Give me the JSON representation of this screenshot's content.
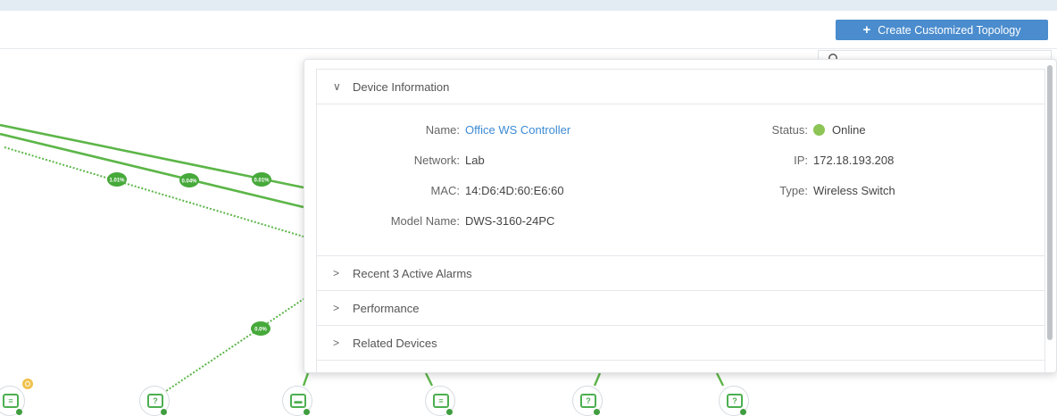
{
  "toolbar": {
    "create_button_label": "Create Customized Topology",
    "search_placeholder": "Search"
  },
  "topology": {
    "link_labels": [
      "1.01%",
      "0.04%",
      "0.01%",
      "0.0%"
    ],
    "link_color": "#5cb648",
    "alert_badge_color": "#f0c14b"
  },
  "panel": {
    "device_info": {
      "title": "Device Information",
      "name_label": "Name:",
      "name_value": "Office WS Controller",
      "network_label": "Network:",
      "network_value": "Lab",
      "mac_label": "MAC:",
      "mac_value": "14:D6:4D:60:E6:60",
      "model_label": "Model Name:",
      "model_value": "DWS-3160-24PC",
      "status_label": "Status:",
      "status_value": "Online",
      "status_color": "#8cc455",
      "ip_label": "IP:",
      "ip_value": "172.18.193.208",
      "type_label": "Type:",
      "type_value": "Wireless Switch"
    },
    "sections": [
      {
        "title": "Recent 3 Active Alarms"
      },
      {
        "title": "Performance"
      },
      {
        "title": "Related Devices"
      }
    ]
  }
}
